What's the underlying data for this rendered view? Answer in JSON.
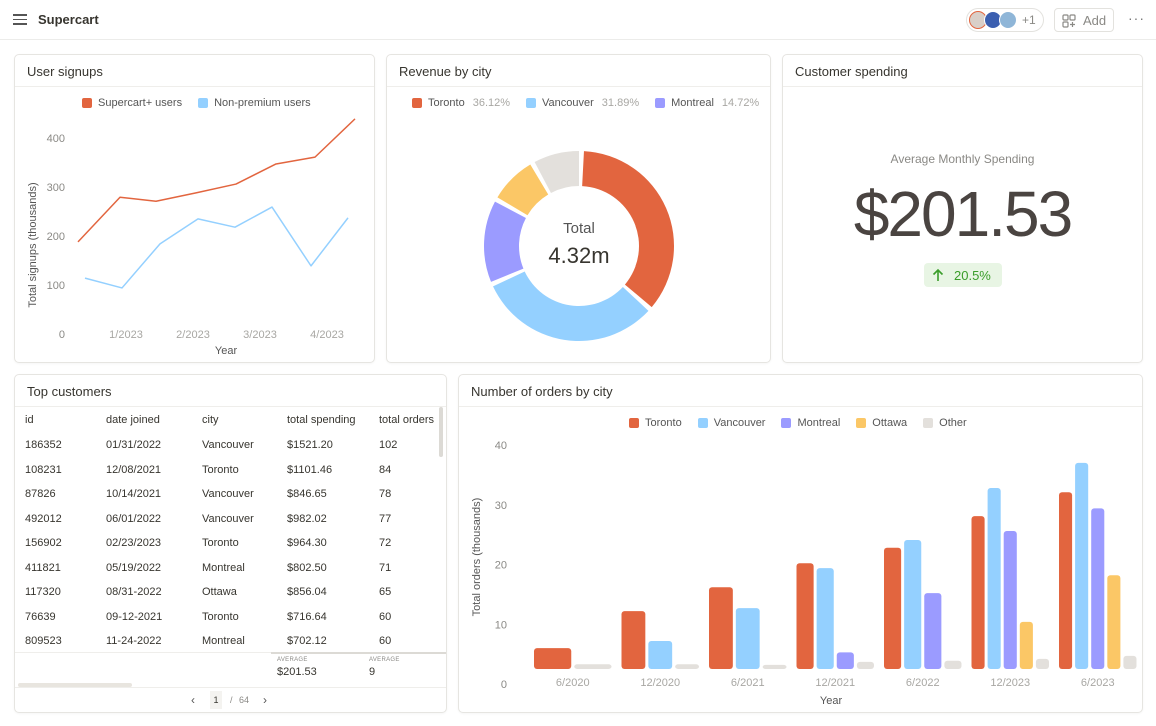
{
  "app": {
    "title": "Supercart",
    "collaborators_extra": "+1",
    "add_label": "Add",
    "more_label": "···"
  },
  "signups": {
    "title": "User signups",
    "chart_data": {
      "type": "line",
      "xlabel": "Year",
      "ylabel": "Total signups (thousands)",
      "ylim": [
        0,
        450
      ],
      "yticks": [
        0,
        100,
        200,
        300,
        400
      ],
      "xtick_labels": [
        "1/2023",
        "2/2023",
        "3/2023",
        "4/2023"
      ],
      "series": [
        {
          "name": "Supercart+ users",
          "color": "#e2653f",
          "values": [
            188,
            279,
            271,
            288,
            306,
            347,
            361,
            439
          ]
        },
        {
          "name": "Non-premium users",
          "color": "#94d0ff",
          "values": [
            114,
            94,
            184,
            235,
            218,
            259,
            139,
            237
          ]
        }
      ]
    }
  },
  "revenue": {
    "title": "Revenue by city",
    "center_label": "Total",
    "center_value": "4.32m",
    "chart_data": {
      "type": "pie",
      "slices": [
        {
          "name": "Toronto",
          "pct_label": "36.12%",
          "value": 36.12,
          "color": "#e2653f"
        },
        {
          "name": "Vancouver",
          "pct_label": "31.89%",
          "value": 31.89,
          "color": "#94d0ff"
        },
        {
          "name": "Montreal",
          "pct_label": "14.72%",
          "value": 14.72,
          "color": "#9b9bff"
        },
        {
          "name": "Ottawa",
          "value": 8.7,
          "color": "#fbc766"
        },
        {
          "name": "Other",
          "value": 8.57,
          "color": "#e3e0dc"
        }
      ]
    }
  },
  "spending": {
    "title": "Customer spending",
    "label": "Average Monthly Spending",
    "value": "$201.53",
    "change": "20.5%",
    "change_color": "#3a9d2a"
  },
  "customers": {
    "title": "Top customers",
    "columns": [
      "id",
      "date joined",
      "city",
      "total spending",
      "total orders"
    ],
    "rows": [
      [
        "186352",
        "01/31/2022",
        "Vancouver",
        "$1521.20",
        "102"
      ],
      [
        "108231",
        "12/08/2021",
        "Toronto",
        "$1101.46",
        "84"
      ],
      [
        "87826",
        "10/14/2021",
        "Vancouver",
        "$846.65",
        "78"
      ],
      [
        "492012",
        "06/01/2022",
        "Vancouver",
        "$982.02",
        "77"
      ],
      [
        "156902",
        "02/23/2023",
        "Toronto",
        "$964.30",
        "72"
      ],
      [
        "411821",
        "05/19/2022",
        "Montreal",
        "$802.50",
        "71"
      ],
      [
        "117320",
        "08/31-2022",
        "Ottawa",
        "$856.04",
        "65"
      ],
      [
        "76639",
        "09-12-2021",
        "Toronto",
        "$716.64",
        "60"
      ],
      [
        "809523",
        "11-24-2022",
        "Montreal",
        "$702.12",
        "60"
      ]
    ],
    "avg_label": "AVERAGE",
    "avg_spending": "$201.53",
    "avg_orders": "9",
    "page": "1",
    "page_sep": "/",
    "pages": "64"
  },
  "orders": {
    "title": "Number of orders by city",
    "chart_data": {
      "type": "bar",
      "xlabel": "Year",
      "ylabel": "Total orders (thousands)",
      "ylim": [
        0,
        40
      ],
      "yticks": [
        0,
        10,
        20,
        30,
        40
      ],
      "categories": [
        "6/2020",
        "12/2020",
        "6/2021",
        "12/2021",
        "6/2022",
        "12/2023",
        "6/2023"
      ],
      "series": [
        {
          "name": "Toronto",
          "color": "#e2653f",
          "values": [
            6,
            12.2,
            16.2,
            20.2,
            22.8,
            28.1,
            32.1
          ]
        },
        {
          "name": "Vancouver",
          "color": "#94d0ff",
          "values": [
            null,
            7.2,
            12.7,
            19.4,
            24.1,
            32.8,
            37
          ]
        },
        {
          "name": "Montreal",
          "color": "#9b9bff",
          "values": [
            null,
            null,
            null,
            5.3,
            15.2,
            25.6,
            29.4
          ]
        },
        {
          "name": "Ottawa",
          "color": "#fbc766",
          "values": [
            null,
            null,
            null,
            null,
            null,
            10.4,
            18.2
          ]
        },
        {
          "name": "Other",
          "color": "#e3e0dc",
          "values": [
            3.3,
            3.3,
            3.2,
            3.7,
            3.9,
            4.2,
            4.7
          ]
        }
      ]
    }
  }
}
